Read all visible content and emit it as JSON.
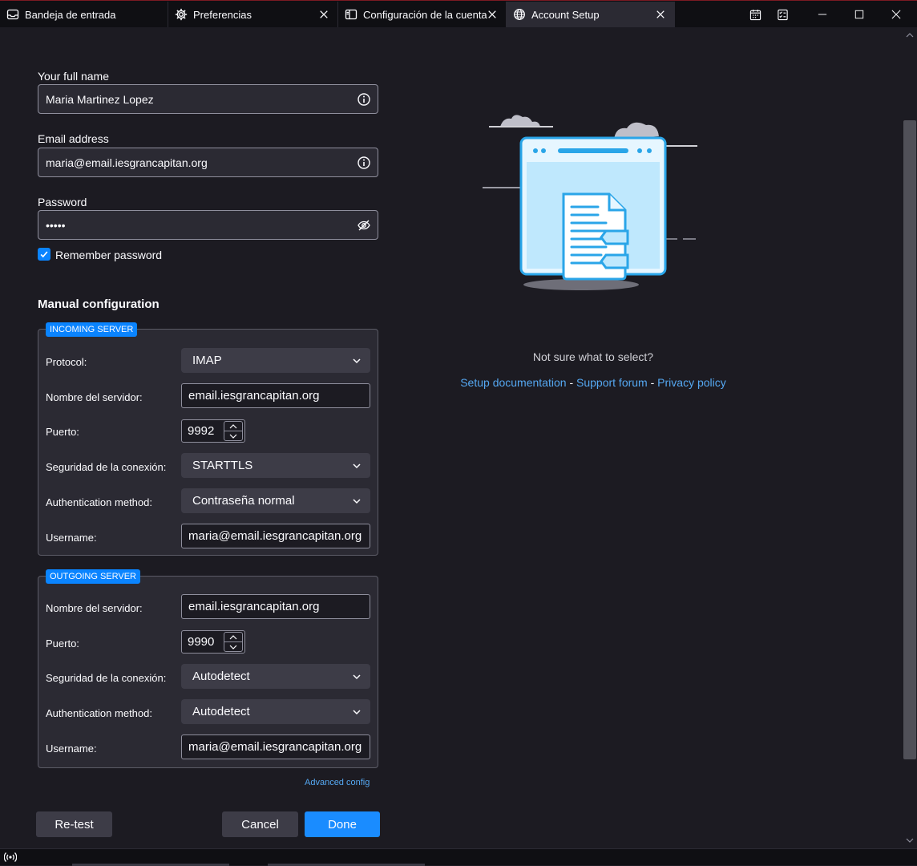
{
  "tabs": [
    {
      "label": "Bandeja de entrada",
      "icon": "inbox-icon"
    },
    {
      "label": "Preferencias",
      "icon": "gear-icon"
    },
    {
      "label": "Configuración de la cuenta",
      "icon": "account-settings-icon"
    },
    {
      "label": "Account Setup",
      "icon": "globe-icon"
    }
  ],
  "colors": {
    "accent": "#0a84ff",
    "link": "#55a8f2",
    "background": "#1c1b22",
    "panel": "#2b2a33"
  },
  "form": {
    "full_name": {
      "label": "Your full name",
      "value": "Maria Martinez Lopez",
      "icon": "info-icon"
    },
    "email": {
      "label": "Email address",
      "value": "maria@email.iesgrancapitan.org",
      "icon": "info-icon"
    },
    "password": {
      "label": "Password",
      "value": "•••••",
      "icon": "eye-slash-icon"
    },
    "remember": {
      "label": "Remember password",
      "checked": true
    }
  },
  "manual": {
    "title": "Manual configuration",
    "incoming": {
      "badge": "INCOMING SERVER",
      "protocol_label": "Protocol:",
      "protocol_value": "IMAP",
      "server_label": "Nombre del servidor:",
      "server_value": "email.iesgrancapitan.org",
      "port_label": "Puerto:",
      "port_value": "9992",
      "security_label": "Seguridad de la conexión:",
      "security_value": "STARTTLS",
      "auth_label": "Authentication method:",
      "auth_value": "Contraseña normal",
      "username_label": "Username:",
      "username_value": "maria@email.iesgrancapitan.org"
    },
    "outgoing": {
      "badge": "OUTGOING SERVER",
      "server_label": "Nombre del servidor:",
      "server_value": "email.iesgrancapitan.org",
      "port_label": "Puerto:",
      "port_value": "9990",
      "security_label": "Seguridad de la conexión:",
      "security_value": "Autodetect",
      "auth_label": "Authentication method:",
      "auth_value": "Autodetect",
      "username_label": "Username:",
      "username_value": "maria@email.iesgrancapitan.org"
    },
    "advanced": "Advanced config"
  },
  "help": {
    "question": "Not sure what to select?",
    "setup_doc": "Setup documentation",
    "sep1": "-",
    "support": "Support forum",
    "sep2": "-",
    "privacy": "Privacy policy"
  },
  "buttons": {
    "retest": "Re-test",
    "cancel": "Cancel",
    "done": "Done"
  }
}
